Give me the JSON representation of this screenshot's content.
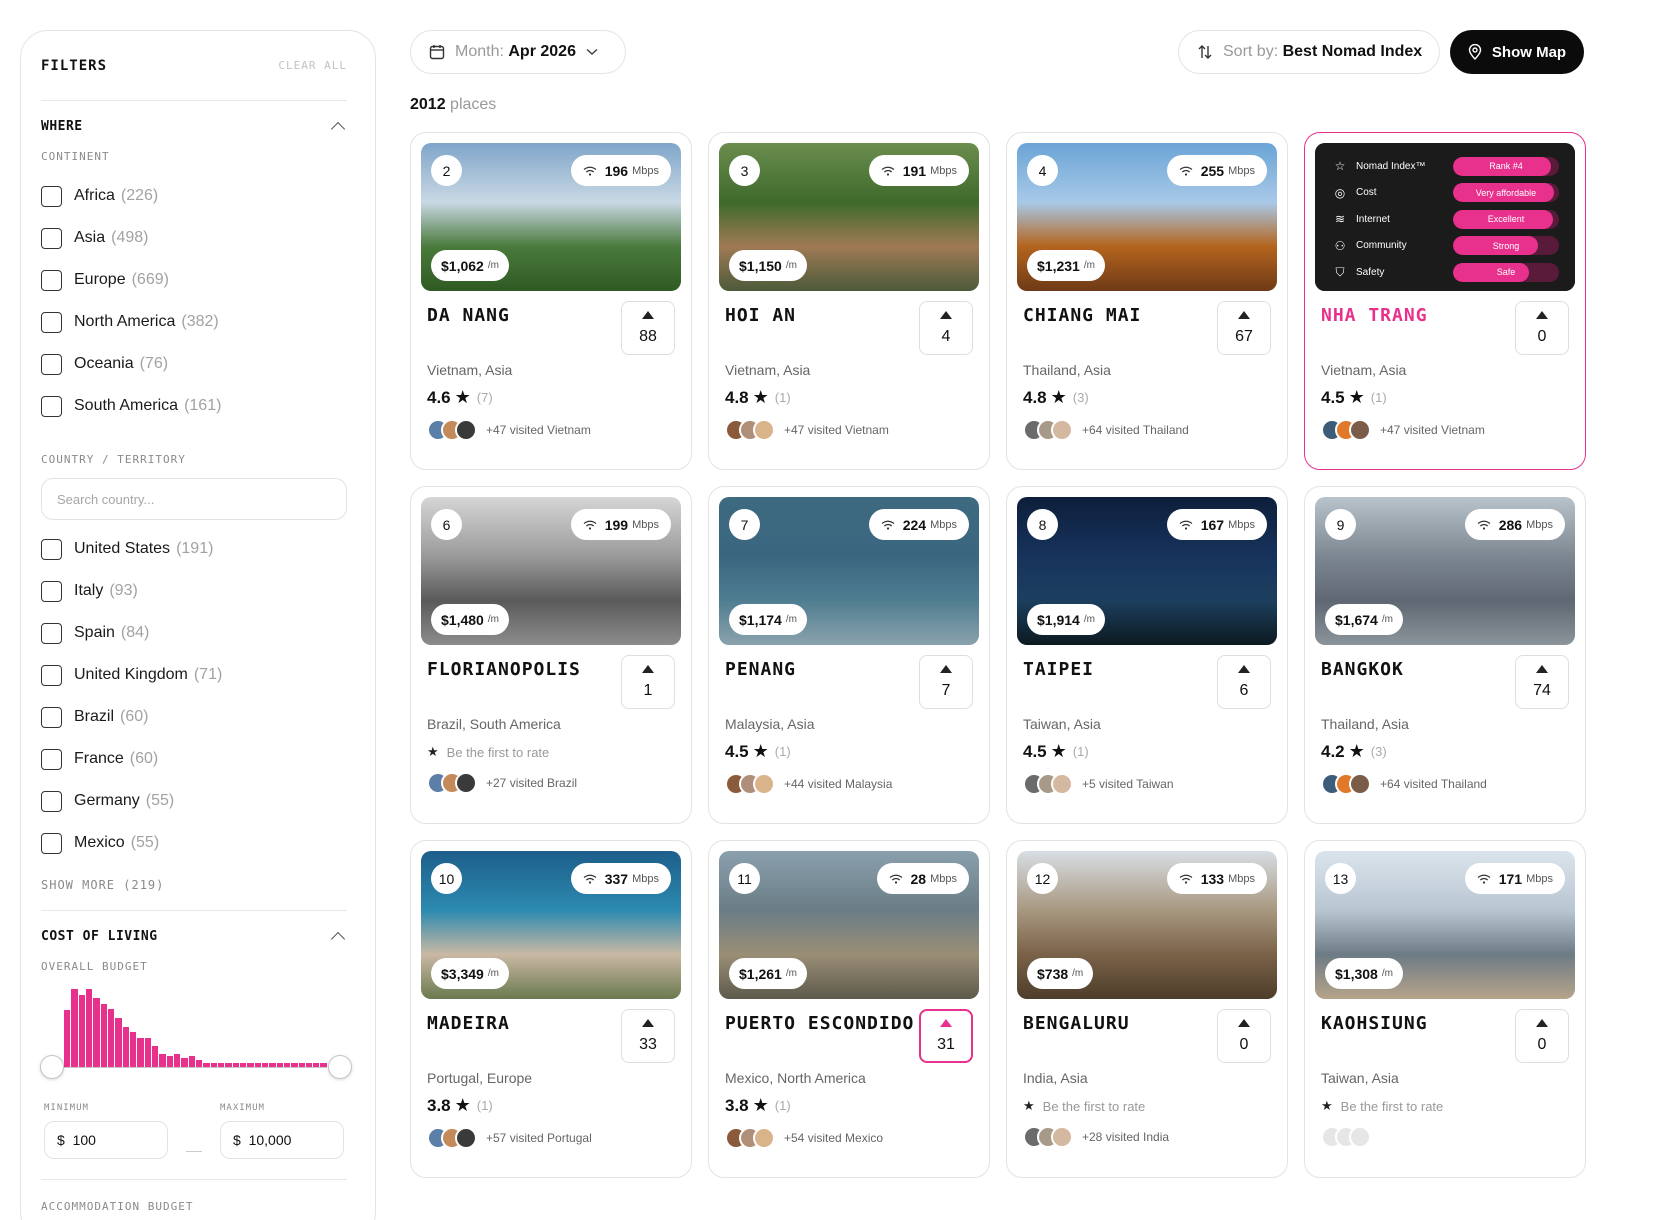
{
  "filters": {
    "title": "FILTERS",
    "clear_all": "CLEAR ALL",
    "where": {
      "title": "WHERE",
      "continent_label": "CONTINENT",
      "continents": [
        {
          "name": "Africa",
          "count": "(226)"
        },
        {
          "name": "Asia",
          "count": "(498)"
        },
        {
          "name": "Europe",
          "count": "(669)"
        },
        {
          "name": "North America",
          "count": "(382)"
        },
        {
          "name": "Oceania",
          "count": "(76)"
        },
        {
          "name": "South America",
          "count": "(161)"
        }
      ],
      "country_label": "COUNTRY / TERRITORY",
      "search_placeholder": "Search country...",
      "countries": [
        {
          "name": "United States",
          "count": "(191)"
        },
        {
          "name": "Italy",
          "count": "(93)"
        },
        {
          "name": "Spain",
          "count": "(84)"
        },
        {
          "name": "United Kingdom",
          "count": "(71)"
        },
        {
          "name": "Brazil",
          "count": "(60)"
        },
        {
          "name": "France",
          "count": "(60)"
        },
        {
          "name": "Germany",
          "count": "(55)"
        },
        {
          "name": "Mexico",
          "count": "(55)"
        }
      ],
      "show_more": "SHOW MORE (219)"
    },
    "cost": {
      "title": "COST OF LIVING",
      "overall_label": "OVERALL BUDGET",
      "histogram": [
        60,
        82,
        76,
        82,
        73,
        66,
        61,
        52,
        42,
        37,
        30,
        30,
        22,
        14,
        12,
        14,
        10,
        12,
        7,
        4,
        4,
        4,
        4,
        4,
        4,
        4,
        4,
        4,
        4,
        4,
        4,
        4,
        4,
        4,
        4,
        4
      ],
      "minimum_label": "MINIMUM",
      "maximum_label": "MAXIMUM",
      "min_value": "100",
      "max_value": "10,000",
      "currency": "$",
      "accommodation_label": "ACCOMMODATION BUDGET",
      "accent": "#e8318d"
    }
  },
  "topbar": {
    "month_label": "Month:",
    "month_value": "Apr 2026",
    "sort_label": "Sort by:",
    "sort_value": "Best Nomad Index",
    "map_button": "Show Map"
  },
  "results": {
    "count": "2012",
    "suffix": "places"
  },
  "nomad_overlay": {
    "rows": [
      {
        "label": "Nomad Index™",
        "value": "Rank #4",
        "icon": "star-icon",
        "fill": 0.92
      },
      {
        "label": "Cost",
        "value": "Very affordable",
        "icon": "globe-icon",
        "fill": 0.95
      },
      {
        "label": "Internet",
        "value": "Excellent",
        "icon": "wifi-icon",
        "fill": 0.94
      },
      {
        "label": "Community",
        "value": "Strong",
        "icon": "people-icon",
        "fill": 0.8
      },
      {
        "label": "Safety",
        "value": "Safe",
        "icon": "shield-icon",
        "fill": 0.72
      }
    ]
  },
  "places": [
    {
      "rank": "2",
      "speed": "196",
      "unit": "Mbps",
      "price": "$1,062",
      "per": "/m",
      "city": "DA NANG",
      "votes": "88",
      "location": "Vietnam, Asia",
      "rating": "4.6",
      "reviews": "(7)",
      "visited": "+47 visited Vietnam",
      "colors": [
        "#7fa5c9",
        "#c9d8e4",
        "#4a7a3c",
        "#2f5a23"
      ]
    },
    {
      "rank": "3",
      "speed": "191",
      "unit": "Mbps",
      "price": "$1,150",
      "per": "/m",
      "city": "HOI AN",
      "votes": "4",
      "location": "Vietnam, Asia",
      "rating": "4.8",
      "reviews": "(1)",
      "visited": "+47 visited Vietnam",
      "colors": [
        "#6b8d4e",
        "#3e6a2c",
        "#a07a54",
        "#4b5a3a"
      ]
    },
    {
      "rank": "4",
      "speed": "255",
      "unit": "Mbps",
      "price": "$1,231",
      "per": "/m",
      "city": "CHIANG MAI",
      "votes": "67",
      "location": "Thailand, Asia",
      "rating": "4.8",
      "reviews": "(3)",
      "visited": "+64 visited Thailand",
      "colors": [
        "#6aa4d6",
        "#a8c9e8",
        "#b4641e",
        "#6e3a16"
      ]
    },
    {
      "rank": "",
      "speed": "",
      "unit": "",
      "price": "",
      "per": "",
      "city": "NHA TRANG",
      "votes": "0",
      "location": "Vietnam, Asia",
      "rating": "4.5",
      "reviews": "(1)",
      "visited": "+47 visited Vietnam",
      "colors": [
        "#1b1b1b",
        "#1b1b1b",
        "#1b1b1b",
        "#1b1b1b"
      ],
      "highlight": true
    },
    {
      "rank": "6",
      "speed": "199",
      "unit": "Mbps",
      "price": "$1,480",
      "per": "/m",
      "city": "FLORIANOPOLIS",
      "votes": "1",
      "location": "Brazil, South America",
      "rating": "",
      "reviews": "",
      "empty_rating": "Be the first to rate",
      "visited": "+27 visited Brazil",
      "colors": [
        "#d6d6d6",
        "#9a9a9a",
        "#5a5a5a",
        "#8c8c8c"
      ]
    },
    {
      "rank": "7",
      "speed": "224",
      "unit": "Mbps",
      "price": "$1,174",
      "per": "/m",
      "city": "PENANG",
      "votes": "7",
      "location": "Malaysia, Asia",
      "rating": "4.5",
      "reviews": "(1)",
      "visited": "+44 visited Malaysia",
      "colors": [
        "#3e6a80",
        "#3a6680",
        "#4f7d90",
        "#8aa2ad"
      ]
    },
    {
      "rank": "8",
      "speed": "167",
      "unit": "Mbps",
      "price": "$1,914",
      "per": "/m",
      "city": "TAIPEI",
      "votes": "6",
      "location": "Taiwan, Asia",
      "rating": "4.5",
      "reviews": "(1)",
      "visited": "+5 visited Taiwan",
      "colors": [
        "#0d1e3a",
        "#17335c",
        "#1d3f5e",
        "#0c1a20"
      ]
    },
    {
      "rank": "9",
      "speed": "286",
      "unit": "Mbps",
      "price": "$1,674",
      "per": "/m",
      "city": "BANGKOK",
      "votes": "74",
      "location": "Thailand, Asia",
      "rating": "4.2",
      "reviews": "(3)",
      "visited": "+64 visited Thailand",
      "colors": [
        "#b9c3cc",
        "#7d8791",
        "#5e6772",
        "#8c949b"
      ]
    },
    {
      "rank": "10",
      "speed": "337",
      "unit": "Mbps",
      "price": "$3,349",
      "per": "/m",
      "city": "MADEIRA",
      "votes": "33",
      "location": "Portugal, Europe",
      "rating": "3.8",
      "reviews": "(1)",
      "visited": "+57 visited Portugal",
      "colors": [
        "#1d5e8a",
        "#2c8ab0",
        "#c9b8a4",
        "#6a7a4e"
      ]
    },
    {
      "rank": "11",
      "speed": "28",
      "unit": "Mbps",
      "price": "$1,261",
      "per": "/m",
      "city": "PUERTO ESCONDIDO",
      "votes": "31",
      "location": "Mexico, North America",
      "rating": "3.8",
      "reviews": "(1)",
      "visited": "+54 visited Mexico",
      "colors": [
        "#8aa0ad",
        "#6a7d86",
        "#9a8e76",
        "#5d5a4b"
      ],
      "pink_vote": true
    },
    {
      "rank": "12",
      "speed": "133",
      "unit": "Mbps",
      "price": "$738",
      "per": "/m",
      "city": "BENGALURU",
      "votes": "0",
      "location": "India, Asia",
      "rating": "",
      "reviews": "",
      "empty_rating": "Be the first to rate",
      "visited": "+28 visited India",
      "colors": [
        "#d8dee4",
        "#a89880",
        "#7a6248",
        "#4e3d2a"
      ]
    },
    {
      "rank": "13",
      "speed": "171",
      "unit": "Mbps",
      "price": "$1,308",
      "per": "/m",
      "city": "KAOHSIUNG",
      "votes": "0",
      "location": "Taiwan, Asia",
      "rating": "",
      "reviews": "",
      "empty_rating": "Be the first to rate",
      "visited": "",
      "colors": [
        "#dbe4ec",
        "#b8c6d2",
        "#6d7b86",
        "#b7a48a"
      ]
    }
  ]
}
